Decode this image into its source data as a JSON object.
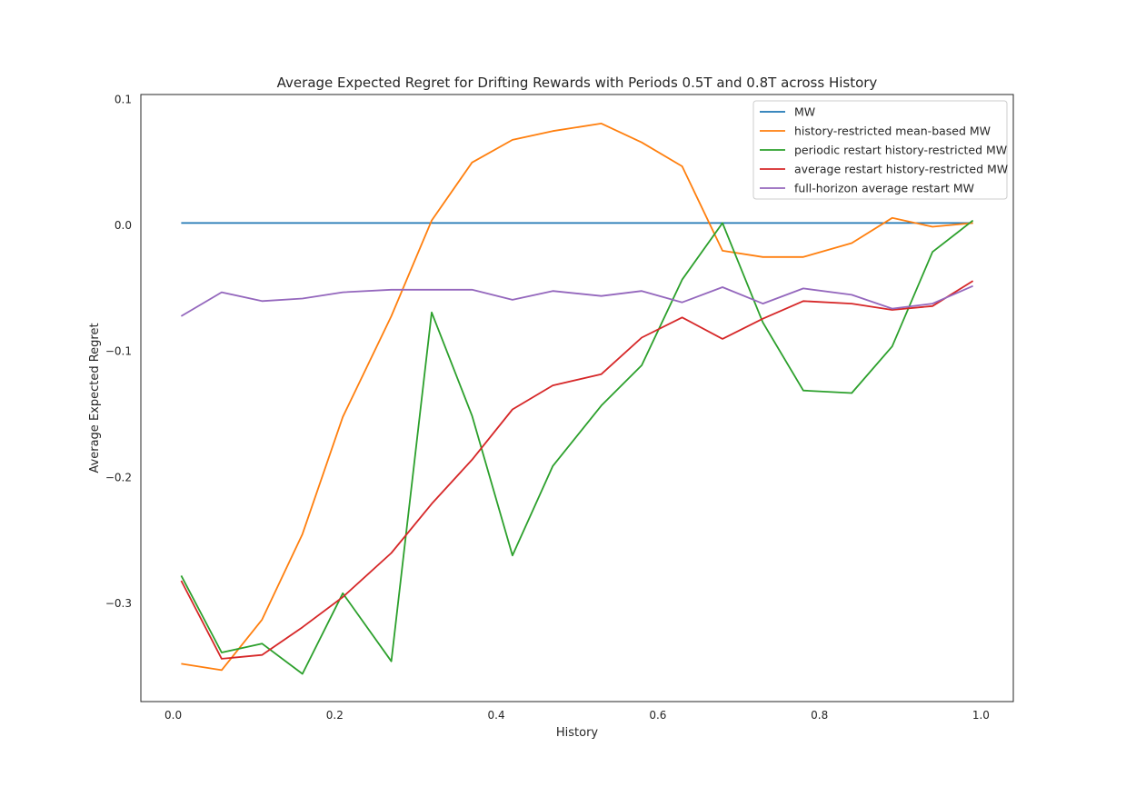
{
  "chart_data": {
    "type": "line",
    "title": "Average Expected Regret for Drifting Rewards with Periods 0.5T and 0.8T across History",
    "xlabel": "History",
    "ylabel": "Average Expected Regret",
    "xlim": [
      -0.04,
      1.04
    ],
    "ylim": [
      -0.378,
      0.104
    ],
    "xticks": [
      0.0,
      0.2,
      0.4,
      0.6,
      0.8,
      1.0
    ],
    "xtick_labels": [
      "0.0",
      "0.2",
      "0.4",
      "0.6",
      "0.8",
      "1.0"
    ],
    "yticks": [
      -0.3,
      -0.2,
      -0.1,
      0.0,
      0.1
    ],
    "ytick_labels": [
      "−0.3",
      "−0.2",
      "−0.1",
      "0.0",
      "0.1"
    ],
    "grid": false,
    "legend_position": "top-right",
    "x": [
      0.01,
      0.06,
      0.11,
      0.16,
      0.21,
      0.27,
      0.32,
      0.37,
      0.42,
      0.47,
      0.53,
      0.58,
      0.63,
      0.68,
      0.73,
      0.78,
      0.84,
      0.89,
      0.94,
      0.99
    ],
    "series": [
      {
        "name": "MW",
        "color": "#1f77b4",
        "values": [
          0.002,
          0.002,
          0.002,
          0.002,
          0.002,
          0.002,
          0.002,
          0.002,
          0.002,
          0.002,
          0.002,
          0.002,
          0.002,
          0.002,
          0.002,
          0.002,
          0.002,
          0.002,
          0.002,
          0.002
        ]
      },
      {
        "name": "history-restricted mean-based MW",
        "color": "#ff7f0e",
        "values": [
          -0.348,
          -0.353,
          -0.313,
          -0.245,
          -0.152,
          -0.072,
          0.004,
          0.05,
          0.068,
          0.075,
          0.081,
          0.066,
          0.047,
          -0.02,
          -0.025,
          -0.025,
          -0.014,
          0.006,
          -0.001,
          0.002
        ]
      },
      {
        "name": "periodic restart history-restricted MW",
        "color": "#2ca02c",
        "values": [
          -0.278,
          -0.339,
          -0.332,
          -0.356,
          -0.292,
          -0.346,
          -0.069,
          -0.151,
          -0.262,
          -0.191,
          -0.143,
          -0.111,
          -0.043,
          0.002,
          -0.077,
          -0.131,
          -0.133,
          -0.096,
          -0.021,
          0.004
        ]
      },
      {
        "name": "average restart history-restricted MW",
        "color": "#d62728",
        "values": [
          -0.282,
          -0.344,
          -0.341,
          -0.319,
          -0.295,
          -0.26,
          -0.221,
          -0.186,
          -0.146,
          -0.127,
          -0.118,
          -0.089,
          -0.073,
          -0.09,
          -0.074,
          -0.06,
          -0.062,
          -0.067,
          -0.064,
          -0.044
        ]
      },
      {
        "name": "full-horizon average restart MW",
        "color": "#9467bd",
        "values": [
          -0.072,
          -0.053,
          -0.06,
          -0.058,
          -0.053,
          -0.051,
          -0.051,
          -0.051,
          -0.059,
          -0.052,
          -0.056,
          -0.052,
          -0.061,
          -0.049,
          -0.062,
          -0.05,
          -0.055,
          -0.066,
          -0.062,
          -0.048
        ]
      }
    ]
  }
}
